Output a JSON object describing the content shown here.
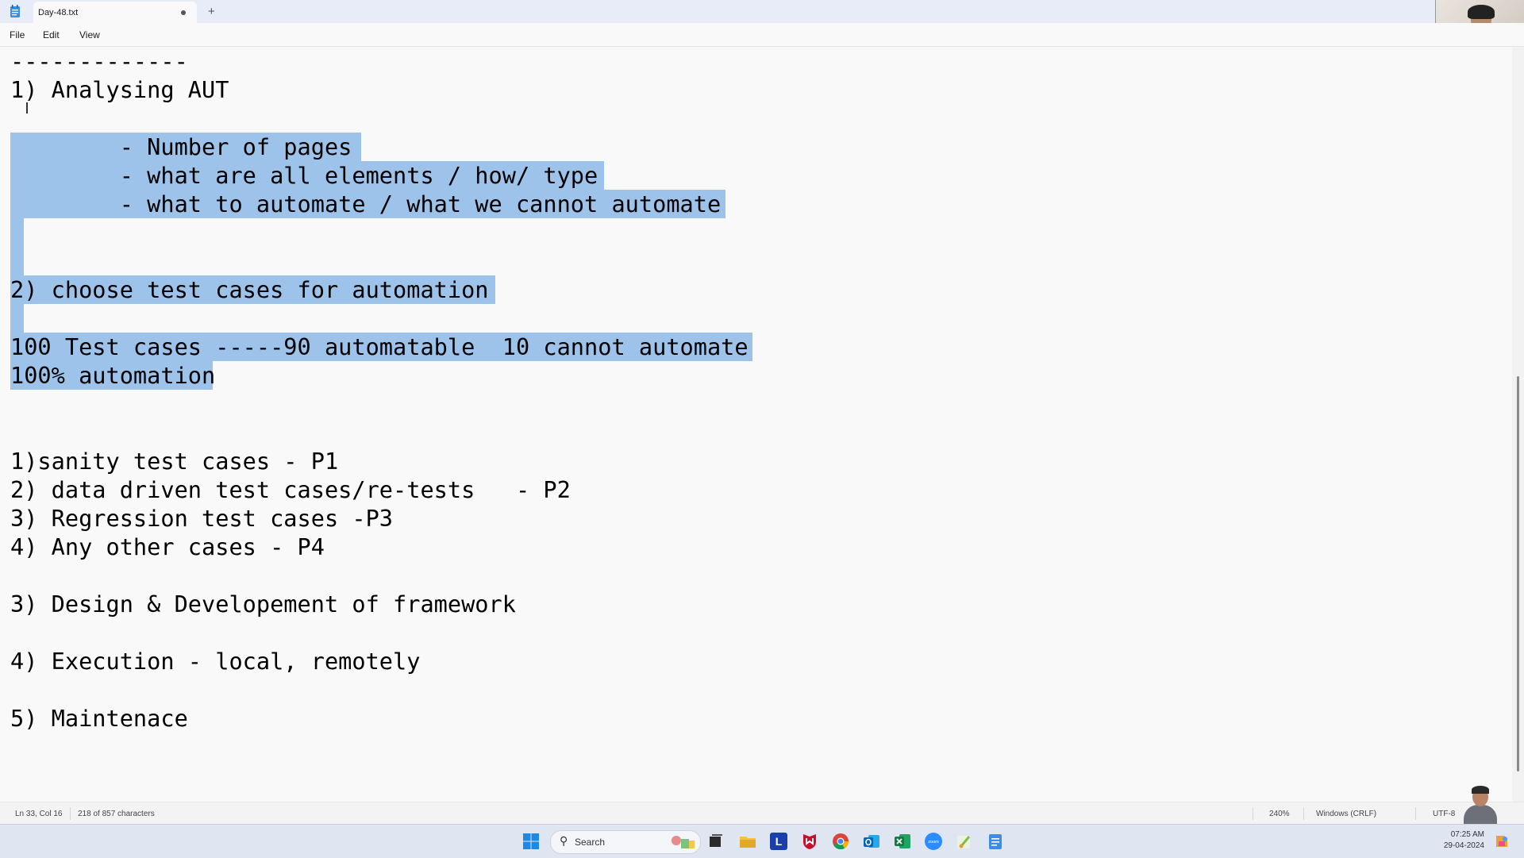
{
  "window": {
    "tab_title": "Day-48.txt",
    "new_tab_glyph": "+",
    "icon": "notepad-icon"
  },
  "menu": {
    "file": "File",
    "edit": "Edit",
    "view": "View"
  },
  "editor": {
    "lines": [
      "-------------",
      "1) Analysing AUT",
      "",
      "        - Number of pages",
      "        - what are all elements / how/ type",
      "        - what to automate / what we cannot automate",
      "",
      "",
      "2) choose test cases for automation",
      "",
      "100 Test cases -----90 automatable  10 cannot automate",
      "100% automation",
      "",
      "",
      "1)sanity test cases - P1",
      "2) data driven test cases/re-tests   - P2",
      "3) Regression test cases -P3",
      "4) Any other cases - P4",
      "",
      "3) Design & Developement of framework",
      "",
      "4) Execution - local, remotely",
      "",
      "5) Maintenace"
    ],
    "selection_color": "#9dc3ea"
  },
  "status": {
    "position": "Ln 33, Col 16",
    "selection": "218 of 857 characters",
    "zoom": "240%",
    "line_ending": "Windows (CRLF)",
    "encoding": "UTF-8"
  },
  "taskbar": {
    "search_placeholder": "Search",
    "time": "07:25 AM",
    "date": "29-04-2024",
    "icons": [
      "windows-start-icon",
      "task-view-icon",
      "file-explorer-icon",
      "l-app-icon",
      "mcafee-icon",
      "chrome-icon",
      "outlook-icon",
      "excel-icon",
      "zoom-icon",
      "paint-icon",
      "notepad-icon"
    ]
  }
}
